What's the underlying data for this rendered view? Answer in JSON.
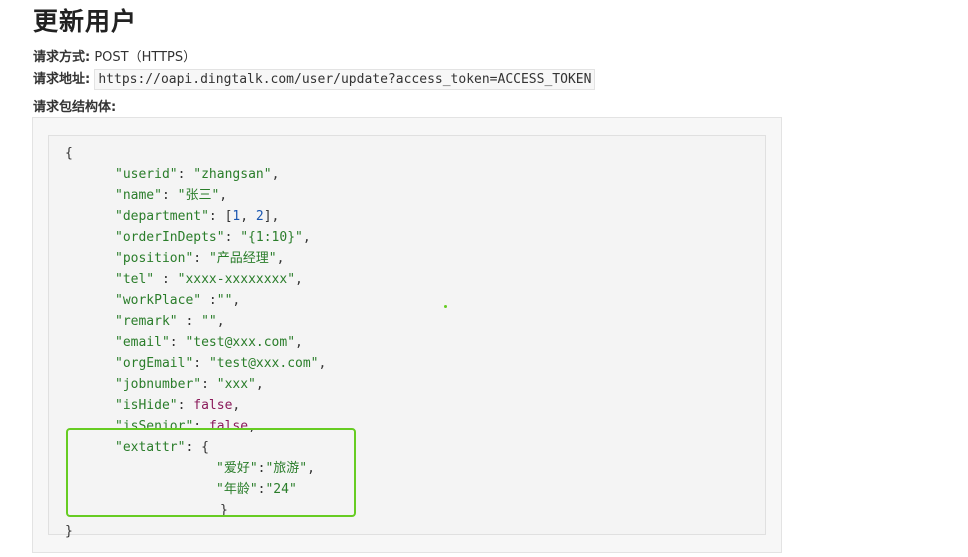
{
  "page": {
    "title": "更新用户",
    "method_label": "请求方式:",
    "method_value": "POST（HTTPS）",
    "url_label": "请求地址:",
    "url_value": "https://oapi.dingtalk.com/user/update?access_token=ACCESS_TOKEN",
    "body_label": "请求包结构体:"
  },
  "code": {
    "open_brace": "{",
    "close_brace": "}",
    "fields": [
      {
        "key": "\"userid\"",
        "sep": ": ",
        "value": "\"zhangsan\"",
        "type": "s",
        "trail": ","
      },
      {
        "key": "\"name\"",
        "sep": ": ",
        "value": "\"张三\"",
        "type": "s",
        "trail": ","
      },
      {
        "key": "\"department\"",
        "sep": ": ",
        "value": "[1, 2]",
        "type": "arr",
        "trail": ","
      },
      {
        "key": "\"orderInDepts\"",
        "sep": ": ",
        "value": "\"{1:10}\"",
        "type": "s",
        "trail": ","
      },
      {
        "key": "\"position\"",
        "sep": ": ",
        "value": "\"产品经理\"",
        "type": "s",
        "trail": ","
      },
      {
        "key": "\"tel\"",
        "sep": " : ",
        "value": "\"xxxx-xxxxxxxx\"",
        "type": "s",
        "trail": ","
      },
      {
        "key": "\"workPlace\"",
        "sep": " :",
        "value": "\"\"",
        "type": "s",
        "trail": ","
      },
      {
        "key": "\"remark\"",
        "sep": " : ",
        "value": "\"\"",
        "type": "s",
        "trail": ","
      },
      {
        "key": "\"email\"",
        "sep": ": ",
        "value": "\"test@xxx.com\"",
        "type": "s",
        "trail": ","
      },
      {
        "key": "\"orgEmail\"",
        "sep": ": ",
        "value": "\"test@xxx.com\"",
        "type": "s",
        "trail": ","
      },
      {
        "key": "\"jobnumber\"",
        "sep": ": ",
        "value": "\"xxx\"",
        "type": "s",
        "trail": ","
      },
      {
        "key": "\"isHide\"",
        "sep": ": ",
        "value": "false",
        "type": "k",
        "trail": ","
      },
      {
        "key": "\"isSenior\"",
        "sep": ": ",
        "value": "false",
        "type": "k",
        "trail": ","
      },
      {
        "key": "\"extattr\"",
        "sep": ": ",
        "value": "{",
        "type": "p",
        "trail": ""
      }
    ],
    "dept_values": [
      "1",
      "2"
    ],
    "extattr": [
      {
        "key": "\"爱好\"",
        "value": "\"旅游\"",
        "trail": ","
      },
      {
        "key": "\"年龄\"",
        "value": "\"24\"",
        "trail": ""
      }
    ],
    "extattr_close": "}"
  },
  "colors": {
    "string": "#2a7d2a",
    "number": "#1a56b0",
    "keyword": "#8a1a5a",
    "highlight": "#66cc22"
  }
}
